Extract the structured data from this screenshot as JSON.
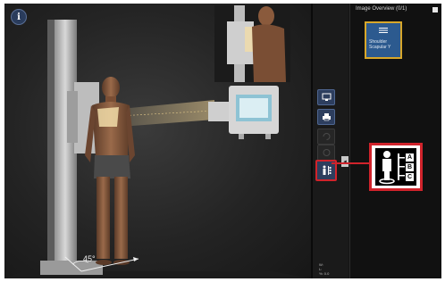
{
  "viewport": {
    "info_button": "i",
    "angle_label": "45°",
    "stats_lines": [
      "W:",
      "L:",
      "%: 0.0"
    ]
  },
  "toolbar": {
    "tools": [
      {
        "icon": "monitor-icon",
        "state": "active"
      },
      {
        "icon": "printer-icon",
        "state": "active"
      },
      {
        "icon": "rotate-icon",
        "state": "disabled"
      },
      {
        "icon": "circle-icon",
        "state": "disabled"
      },
      {
        "icon": "patient-position-icon",
        "state": "highlighted"
      }
    ],
    "expand_glyph": "◂"
  },
  "panel": {
    "title": "Image Overview (0/1)",
    "thumbnails": [
      {
        "label_line1": "Shoulder",
        "label_line2": "Scapular Y"
      }
    ]
  },
  "callout": {
    "letters": [
      "A",
      "B",
      "C"
    ]
  },
  "colors": {
    "highlight": "#d0232b",
    "thumbnail_bg": "#2c5a8f",
    "thumbnail_border": "#d8a72a",
    "tool_bg": "#2d3e5e"
  }
}
